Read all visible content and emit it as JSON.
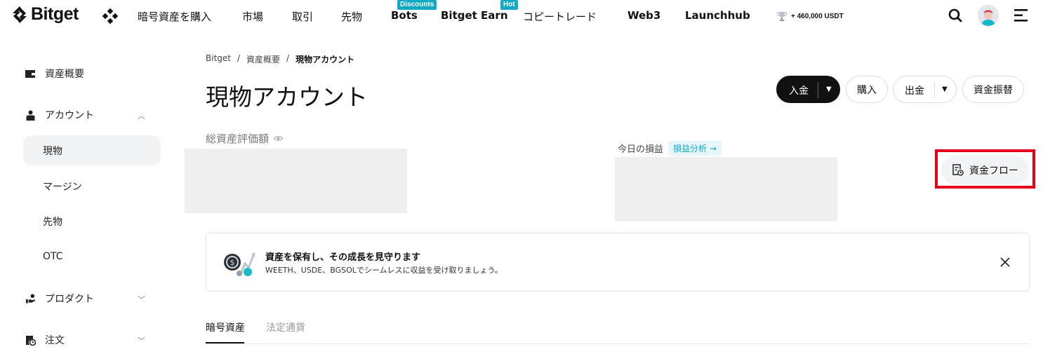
{
  "nav": {
    "logo": "Bitget",
    "items": [
      {
        "label": "暗号資産を購入"
      },
      {
        "label": "市場"
      },
      {
        "label": "取引"
      },
      {
        "label": "先物"
      },
      {
        "label": "Bots",
        "badge": "Discounts"
      },
      {
        "label": "Bitget Earn",
        "badge": "Hot"
      },
      {
        "label": "コピートレード"
      },
      {
        "label": "Web3"
      },
      {
        "label": "Launchhub"
      }
    ],
    "promo": "+ 460,000 USDT",
    "accent": "#10a9c4"
  },
  "sidebar": {
    "items": [
      {
        "label": "資産概要",
        "icon": "wallet-icon"
      },
      {
        "label": "アカウント",
        "icon": "account-icon",
        "expanded": true
      },
      {
        "label": "プロダクト",
        "icon": "product-icon",
        "expanded": false
      },
      {
        "label": "注文",
        "icon": "order-icon",
        "expanded": false
      }
    ],
    "subitems": [
      {
        "label": "現物",
        "active": true
      },
      {
        "label": "マージン"
      },
      {
        "label": "先物"
      },
      {
        "label": "OTC"
      }
    ]
  },
  "breadcrumb": [
    "Bitget",
    "資産概要",
    "現物アカウント"
  ],
  "page": {
    "title": "現物アカウント",
    "buttons": {
      "deposit": "入金",
      "buy": "購入",
      "withdraw": "出金",
      "transfer": "資金振替"
    },
    "total_label": "総資産評価額",
    "pnl_label": "今日の損益",
    "pnl_tag": "損益分析 →",
    "flow_button": "資金フロー",
    "highlight_color": "#e6001a"
  },
  "banner": {
    "title": "資産を保有し、その成長を見守ります",
    "subtitle": "WEETH、USDE、BGSOLでシームレスに収益を受け取りましょう。"
  },
  "tabs": [
    {
      "label": "暗号資産",
      "active": true
    },
    {
      "label": "法定通貨",
      "active": false
    }
  ]
}
